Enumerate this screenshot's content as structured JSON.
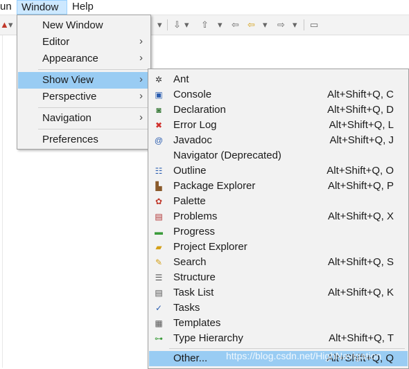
{
  "menubar": {
    "items": [
      {
        "label": "un"
      },
      {
        "label": "Window"
      },
      {
        "label": "Help"
      }
    ]
  },
  "window_menu": {
    "items": [
      {
        "label": "New Window",
        "submenu": false
      },
      {
        "label": "Editor",
        "submenu": true
      },
      {
        "label": "Appearance",
        "submenu": true
      },
      {
        "label": "Show View",
        "submenu": true,
        "highlighted": true
      },
      {
        "label": "Perspective",
        "submenu": true
      },
      {
        "label": "Navigation",
        "submenu": true
      },
      {
        "label": "Preferences",
        "submenu": false
      }
    ],
    "arrow": "›"
  },
  "show_view_menu": {
    "items": [
      {
        "label": "Ant",
        "shortcut": "",
        "icon": "ant-icon"
      },
      {
        "label": "Console",
        "shortcut": "Alt+Shift+Q, C",
        "icon": "console-icon"
      },
      {
        "label": "Declaration",
        "shortcut": "Alt+Shift+Q, D",
        "icon": "declaration-icon"
      },
      {
        "label": "Error Log",
        "shortcut": "Alt+Shift+Q, L",
        "icon": "error-log-icon"
      },
      {
        "label": "Javadoc",
        "shortcut": "Alt+Shift+Q, J",
        "icon": "javadoc-icon"
      },
      {
        "label": "Navigator (Deprecated)",
        "shortcut": "",
        "icon": "navigator-icon"
      },
      {
        "label": "Outline",
        "shortcut": "Alt+Shift+Q, O",
        "icon": "outline-icon"
      },
      {
        "label": "Package Explorer",
        "shortcut": "Alt+Shift+Q, P",
        "icon": "package-explorer-icon"
      },
      {
        "label": "Palette",
        "shortcut": "",
        "icon": "palette-icon"
      },
      {
        "label": "Problems",
        "shortcut": "Alt+Shift+Q, X",
        "icon": "problems-icon"
      },
      {
        "label": "Progress",
        "shortcut": "",
        "icon": "progress-icon"
      },
      {
        "label": "Project Explorer",
        "shortcut": "",
        "icon": "project-explorer-icon"
      },
      {
        "label": "Search",
        "shortcut": "Alt+Shift+Q, S",
        "icon": "search-icon"
      },
      {
        "label": "Structure",
        "shortcut": "",
        "icon": "structure-icon"
      },
      {
        "label": "Task List",
        "shortcut": "Alt+Shift+Q, K",
        "icon": "task-list-icon"
      },
      {
        "label": "Tasks",
        "shortcut": "",
        "icon": "tasks-icon"
      },
      {
        "label": "Templates",
        "shortcut": "",
        "icon": "templates-icon"
      },
      {
        "label": "Type Hierarchy",
        "shortcut": "Alt+Shift+Q, T",
        "icon": "type-hierarchy-icon"
      },
      {
        "label": "Other...",
        "shortcut": "Alt+Shift+Q, Q",
        "icon": "",
        "highlighted": true
      }
    ]
  },
  "watermark": "https://blog.csdn.net/HighNavigation",
  "colors": {
    "highlight": "#99ccf3",
    "menu_bg": "#f2f2f2",
    "active_menubar": "#cde8ff"
  }
}
